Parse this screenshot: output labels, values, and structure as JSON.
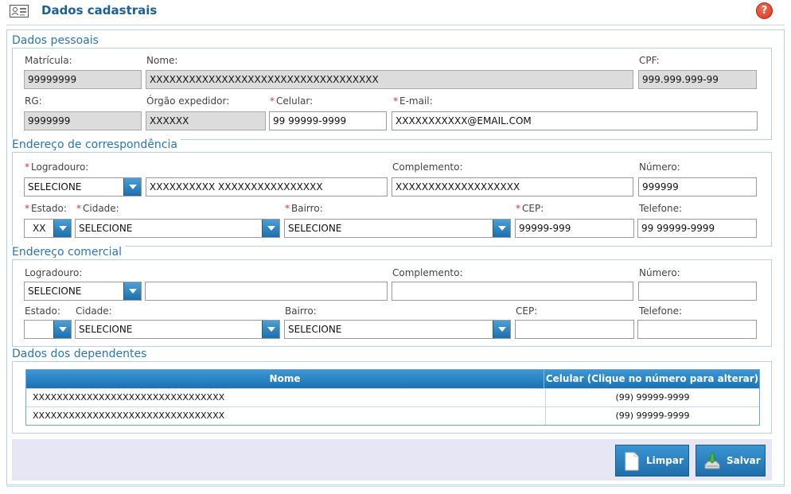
{
  "header": {
    "title": "Dados cadastrais",
    "help_glyph": "?"
  },
  "sections": {
    "pessoais": "Dados pessoais",
    "correspondencia": "Endereço de correspondência",
    "comercial": "Endereço comercial",
    "dependentes": "Dados dos dependentes"
  },
  "pessoais": {
    "matricula_label": "Matrícula:",
    "matricula_value": "99999999",
    "nome_label": "Nome:",
    "nome_value": "XXXXXXXXXXXXXXXXXXXXXXXXXXXXXXXXXXX",
    "cpf_label": "CPF:",
    "cpf_value": "999.999.999-99",
    "rg_label": "RG:",
    "rg_value": "9999999",
    "orgao_label": "Órgão expedidor:",
    "orgao_value": "XXXXXX",
    "celular_label": "Celular:",
    "celular_value": "99 99999-9999",
    "email_label": "E-mail:",
    "email_value": "XXXXXXXXXXX@EMAIL.COM"
  },
  "correspondencia": {
    "logradouro_label": "Logradouro:",
    "logradouro_tipo": "SELECIONE",
    "logradouro_value": "XXXXXXXXXX XXXXXXXXXXXXXXXX",
    "complemento_label": "Complemento:",
    "complemento_value": "XXXXXXXXXXXXXXXXXXX",
    "numero_label": "Número:",
    "numero_value": "999999",
    "estado_label": "Estado:",
    "estado_value": "XX",
    "cidade_label": "Cidade:",
    "cidade_value": "SELECIONE",
    "bairro_label": "Bairro:",
    "bairro_value": "SELECIONE",
    "cep_label": "CEP:",
    "cep_value": "99999-999",
    "telefone_label": "Telefone:",
    "telefone_value": "99 99999-9999"
  },
  "comercial": {
    "logradouro_label": "Logradouro:",
    "logradouro_tipo": "SELECIONE",
    "logradouro_value": "",
    "complemento_label": "Complemento:",
    "complemento_value": "",
    "numero_label": "Número:",
    "numero_value": "",
    "estado_label": "Estado:",
    "estado_value": "",
    "cidade_label": "Cidade:",
    "cidade_value": "SELECIONE",
    "bairro_label": "Bairro:",
    "bairro_value": "SELECIONE",
    "cep_label": "CEP:",
    "cep_value": "",
    "telefone_label": "Telefone:",
    "telefone_value": ""
  },
  "dependentes": {
    "columns": [
      "Nome",
      "Celular (Clique no número para alterar)"
    ],
    "rows": [
      {
        "nome": "XXXXXXXXXXXXXXXXXXXXXXXXXXXXXXXX",
        "celular": "(99) 99999-9999"
      },
      {
        "nome": "XXXXXXXXXXXXXXXXXXXXXXXXXXXXXXXX",
        "celular": "(99) 99999-9999"
      }
    ]
  },
  "actions": {
    "limpar": "Limpar",
    "salvar": "Salvar"
  },
  "required_mark": "*",
  "icons": {
    "header": "id-card-icon",
    "help": "help-icon",
    "dropdown": "chevron-down-icon",
    "limpar": "blank-page-icon",
    "salvar": "download-tray-icon"
  },
  "colors": {
    "accent": "#1a72b4",
    "title": "#1a5f99",
    "required": "#e0302a",
    "readonly": "#dcdcdc",
    "help": "#d13a23"
  }
}
